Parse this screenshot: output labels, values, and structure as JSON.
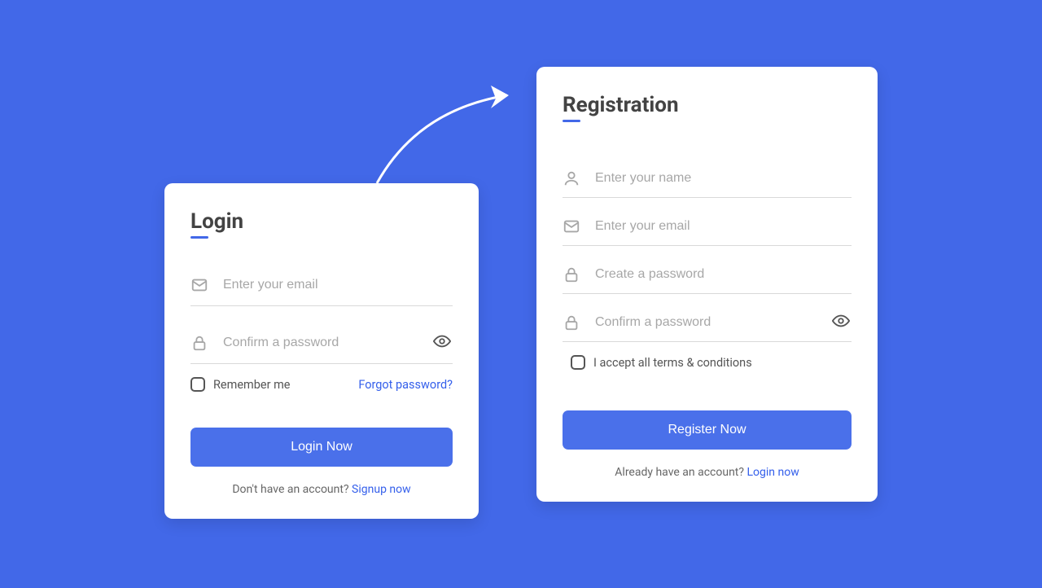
{
  "login": {
    "title": "Login",
    "email_placeholder": "Enter your email",
    "password_placeholder": "Confirm a password",
    "remember_label": "Remember me",
    "forgot_label": "Forgot password?",
    "button_label": "Login Now",
    "footer_text": "Don't have an account? ",
    "footer_link": "Signup now"
  },
  "register": {
    "title": "Registration",
    "name_placeholder": "Enter your name",
    "email_placeholder": "Enter your email",
    "password_placeholder": "Create a password",
    "confirm_placeholder": "Confirm a password",
    "terms_label": "I accept all terms & conditions",
    "button_label": "Register Now",
    "footer_text": "Already  have an account? ",
    "footer_link": "Login now"
  }
}
